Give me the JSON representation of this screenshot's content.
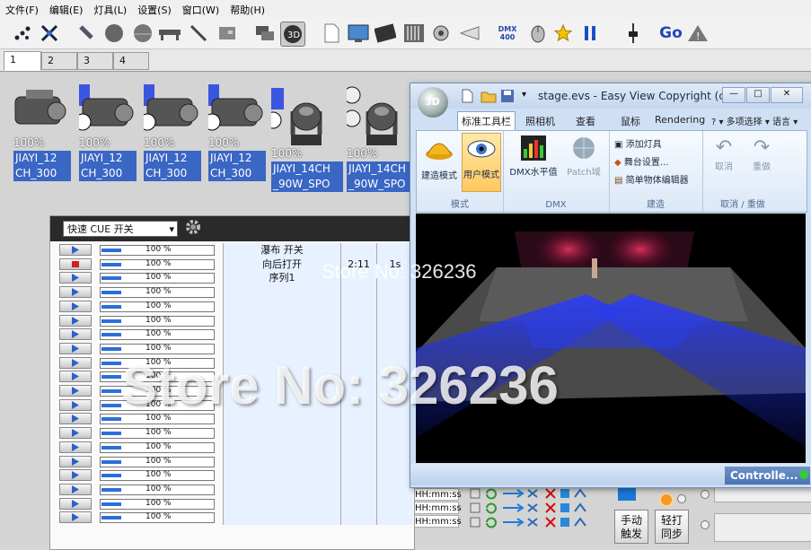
{
  "menu": [
    "文件(F)",
    "编辑(E)",
    "灯具(L)",
    "设置(S)",
    "窗口(W)",
    "帮助(H)"
  ],
  "toolbar_icons": [
    "scatter-select-icon",
    "cross-select-icon",
    "brush-icon",
    "circle-icon",
    "dome-icon",
    "truss-icon",
    "line-tool-icon",
    "panel-icon",
    "layers-icon",
    "3d-view-icon",
    "new-document-icon",
    "cue-icon",
    "keyboard-icon",
    "fader-icon",
    "speaker-icon",
    "beam-icon",
    "dmx400-icon",
    "mouse-icon",
    "star-icon",
    "pause-icon",
    "fader-single-icon",
    "go-icon",
    "warning-icon"
  ],
  "toolbar": {
    "dmx_label": "DMX\n400",
    "go_label": "Go"
  },
  "page_tabs": [
    "1",
    "2",
    "3",
    "4"
  ],
  "fixtures": [
    {
      "pct": "100%",
      "label1": "JIAYI_12",
      "label2": "CH_300"
    },
    {
      "pct": "100%",
      "label1": "JIAYI_12",
      "label2": "CH_300"
    },
    {
      "pct": "100%",
      "label1": "JIAYI_12",
      "label2": "CH_300"
    },
    {
      "pct": "100%",
      "label1": "JIAYI_12",
      "label2": "CH_300"
    },
    {
      "pct": "100%",
      "label1": "JIAYI_14CH",
      "label2": "_90W_SPO"
    },
    {
      "pct": "100%",
      "label1": "JIAYI_14CH",
      "label2": "_90W_SPO"
    }
  ],
  "cue": {
    "selector": "快速 CUE 开关",
    "rows": [
      {
        "value": "100 %",
        "name": "瀑布 开关",
        "a": "",
        "b": "",
        "state": "play"
      },
      {
        "value": "100 %",
        "name": "向后打开",
        "a": "2:11",
        "b": "1s",
        "state": "stop"
      },
      {
        "value": "100 %",
        "name": "序列1",
        "a": "",
        "b": "",
        "state": "play"
      },
      {
        "value": "100 %",
        "name": "",
        "a": "",
        "b": "",
        "state": "play"
      },
      {
        "value": "100 %",
        "name": "",
        "a": "",
        "b": "",
        "state": "play"
      },
      {
        "value": "100 %",
        "name": "",
        "a": "",
        "b": "",
        "state": "play"
      },
      {
        "value": "100 %",
        "name": "",
        "a": "",
        "b": "",
        "state": "play"
      },
      {
        "value": "100 %",
        "name": "",
        "a": "",
        "b": "",
        "state": "play"
      },
      {
        "value": "100 %",
        "name": "",
        "a": "",
        "b": "",
        "state": "play"
      },
      {
        "value": "100 %",
        "name": "",
        "a": "",
        "b": "",
        "state": "play"
      },
      {
        "value": "100 %",
        "name": "",
        "a": "",
        "b": "",
        "state": "play"
      },
      {
        "value": "100 %",
        "name": "",
        "a": "",
        "b": "",
        "state": "play"
      },
      {
        "value": "100 %",
        "name": "",
        "a": "",
        "b": "",
        "state": "play"
      },
      {
        "value": "100 %",
        "name": "",
        "a": "",
        "b": "",
        "state": "play"
      },
      {
        "value": "100 %",
        "name": "",
        "a": "",
        "b": "",
        "state": "play"
      },
      {
        "value": "100 %",
        "name": "",
        "a": "",
        "b": "",
        "state": "play"
      },
      {
        "value": "100 %",
        "name": "",
        "a": "",
        "b": "",
        "state": "play"
      },
      {
        "value": "100 %",
        "name": "",
        "a": "",
        "b": "",
        "state": "play"
      },
      {
        "value": "100 %",
        "name": "",
        "a": "",
        "b": "",
        "state": "play"
      },
      {
        "value": "100 %",
        "name": "",
        "a": "",
        "b": "",
        "state": "play"
      }
    ],
    "time_format": "HH:mm:ss"
  },
  "window3d": {
    "title": "stage.evs - Easy View   Copyright (c...",
    "logo": "3D",
    "controls": [
      "—",
      "□",
      "✕"
    ],
    "tabs": [
      "标准工具栏",
      "照相机",
      "查看",
      "鼠标",
      "Rendering"
    ],
    "tab_extra": "?  ▾  多项选择 ▾  语言 ▾",
    "groups": {
      "mode": {
        "label": "模式",
        "b1": "建造模式",
        "b2": "用户模式"
      },
      "dmx": {
        "label": "DMX",
        "b1": "DMX水平值",
        "b2": "Patch域"
      },
      "build": {
        "label": "建造",
        "b1": "添加灯具",
        "b2": "舞台设置...",
        "b3": "简单物体编辑器"
      },
      "undo": {
        "label": "取消 / 重做",
        "b1": "取消",
        "b2": "重做"
      }
    },
    "status_tab": "Controlle..."
  },
  "right_buttons": {
    "manual": "手动\n触发",
    "tap": "轻打\n同步"
  },
  "watermark": {
    "small": "Store No: 326236",
    "big": "Store No: 326236"
  },
  "colors": {
    "selection": "#3a66c4",
    "window_frame": "#6e8fb8",
    "beam": "#2b3cff"
  }
}
